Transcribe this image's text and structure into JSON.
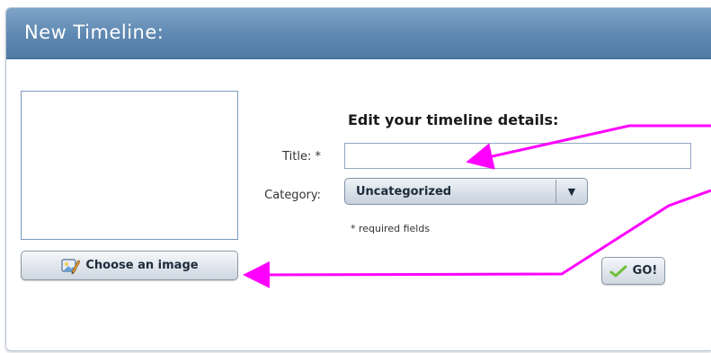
{
  "dialog": {
    "title": "New Timeline:"
  },
  "form": {
    "heading": "Edit your timeline details:",
    "title_label": "Title: *",
    "title_value": "",
    "category_label": "Category:",
    "category_selected": "Uncategorized",
    "required_note": "* required fields"
  },
  "buttons": {
    "choose_image_label": "Choose an image",
    "go_label": "GO!"
  },
  "icons": {
    "choose_image_icon": "pencil-picture-icon",
    "go_icon": "checkmark-icon",
    "dropdown_icon": "triangle-down-icon"
  },
  "colors": {
    "header": "#5e88b1",
    "annotation_arrow": "#ff00ff",
    "input_border": "#8fa7c1"
  }
}
